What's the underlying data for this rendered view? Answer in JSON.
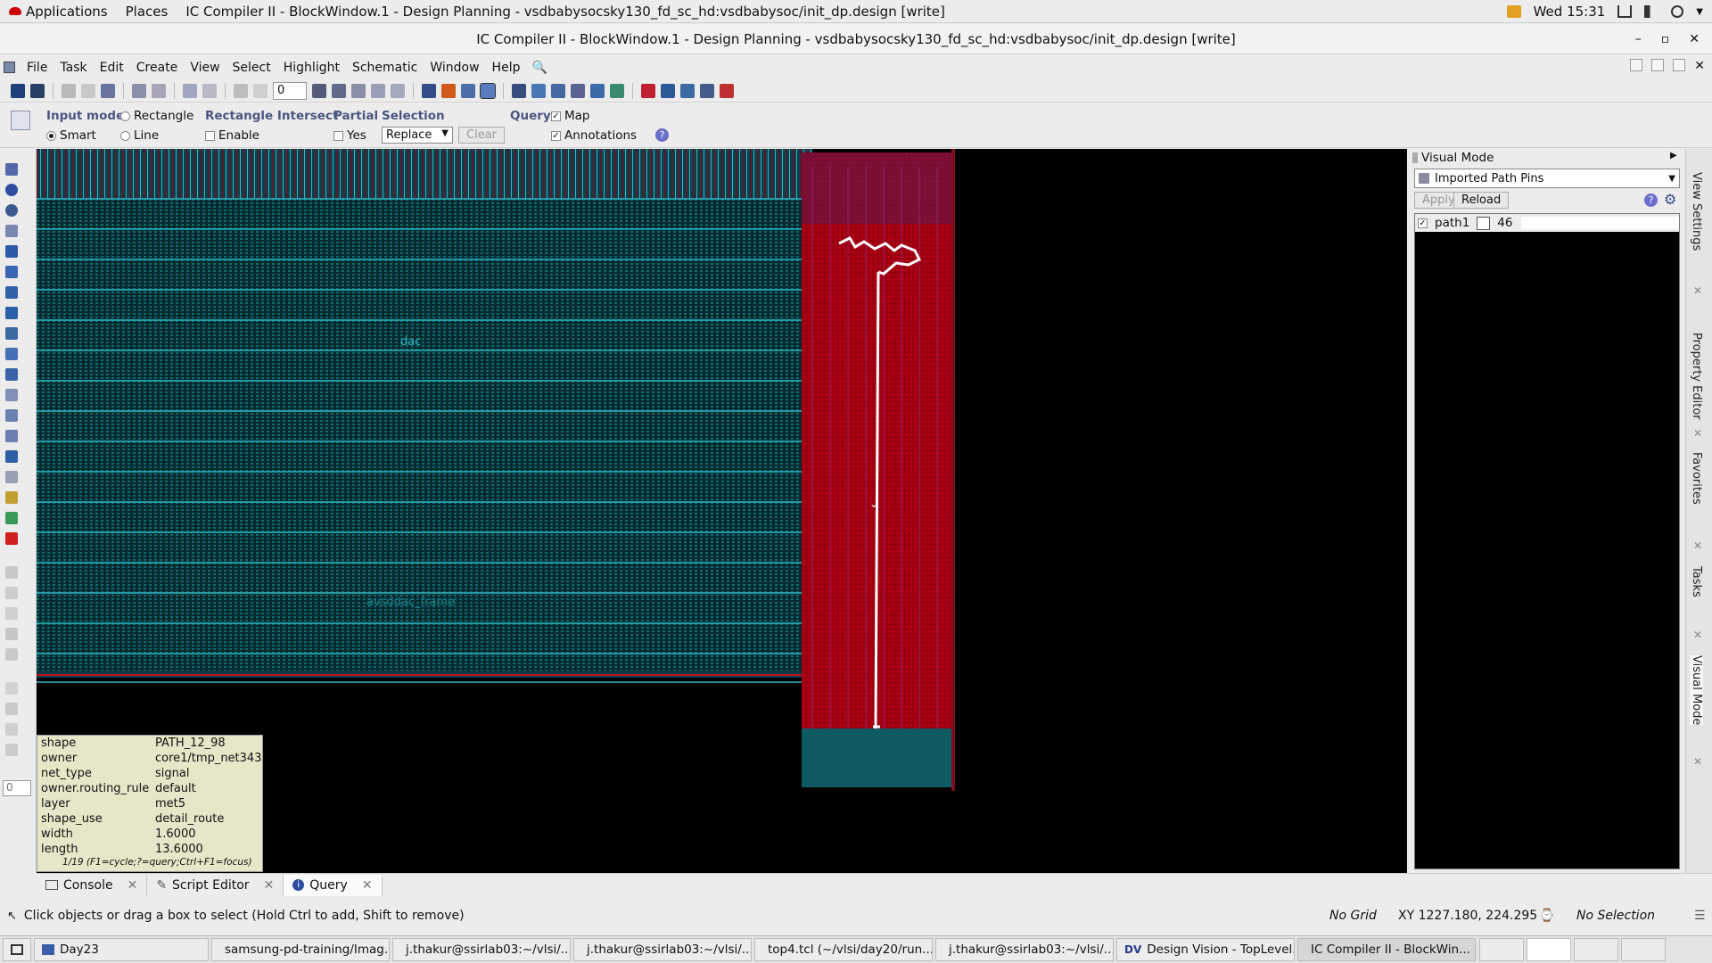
{
  "gnome_bar": {
    "applications": "Applications",
    "places": "Places",
    "window_title": "IC Compiler II - BlockWindow.1 - Design Planning - vsdbabysocsky130_fd_sc_hd:vsdbabysoc/init_dp.design [write]",
    "clock": "Wed 15:31"
  },
  "window": {
    "title": "IC Compiler II - BlockWindow.1 - Design Planning - vsdbabysocsky130_fd_sc_hd:vsdbabysoc/init_dp.design [write]"
  },
  "menu": {
    "items": [
      "File",
      "Task",
      "Edit",
      "Create",
      "View",
      "Select",
      "Highlight",
      "Schematic",
      "Window",
      "Help"
    ]
  },
  "toolbar": {
    "spin_value": "0"
  },
  "options": {
    "input_mode_label": "Input mode",
    "rectangle": "Rectangle",
    "smart": "Smart",
    "line": "Line",
    "rect_intersect_label": "Rectangle Intersect",
    "enable": "Enable",
    "partial_label": "Partial",
    "yes": "Yes",
    "selection_label": "Selection",
    "selection_value": "Replace",
    "clear": "Clear",
    "query_label": "Query",
    "map": "Map",
    "annotations": "Annotations"
  },
  "canvas": {
    "label_dac": "dac",
    "label_frame": "avsddac_frame"
  },
  "query": {
    "rows": [
      {
        "k": "shape",
        "v": "PATH_12_98"
      },
      {
        "k": "owner",
        "v": "core1/tmp_net343"
      },
      {
        "k": "net_type",
        "v": "signal"
      },
      {
        "k": "owner.routing_rule",
        "v": "default"
      },
      {
        "k": "layer",
        "v": "met5"
      },
      {
        "k": "shape_use",
        "v": "detail_route"
      },
      {
        "k": "width",
        "v": "1.6000"
      },
      {
        "k": "length",
        "v": "13.6000"
      }
    ],
    "footer": "1/19 (F1=cycle;?=query;Ctrl+F1=focus)"
  },
  "left_spin": "0",
  "right_panel": {
    "header": "Visual Mode",
    "mode_select": "Imported Path Pins",
    "apply": "Apply",
    "reload": "Reload",
    "path_name": "path1",
    "path_count": "46"
  },
  "side_tabs": [
    "View Settings",
    "Property Editor",
    "Favorites",
    "Tasks",
    "Visual Mode"
  ],
  "bottom_tabs": {
    "console": "Console",
    "script_editor": "Script Editor",
    "query": "Query"
  },
  "status": {
    "message": "Click objects or drag a box to select (Hold Ctrl to add, Shift to remove)",
    "grid": "No Grid",
    "xy": "XY 1227.180, 224.295",
    "selection": "No Selection"
  },
  "taskbar": {
    "items": [
      "Day23",
      "samsung-pd-training/Imag...",
      "j.thakur@ssirlab03:~/vlsi/...",
      "j.thakur@ssirlab03:~/vlsi/...",
      "top4.tcl (~/vlsi/day20/run...",
      "j.thakur@ssirlab03:~/vlsi/...",
      "Design Vision - TopLevel...",
      "IC Compiler II - BlockWin..."
    ]
  },
  "colors": {
    "canvas_bg": "#000000",
    "cell_teal": "#0e6b73",
    "rail_cyan": "#2fb8c4",
    "macro_red": "#b00010",
    "route_magenta": "#8a2a7a",
    "path_white": "#ffffff",
    "tooltip_bg": "#e8e6c8"
  }
}
